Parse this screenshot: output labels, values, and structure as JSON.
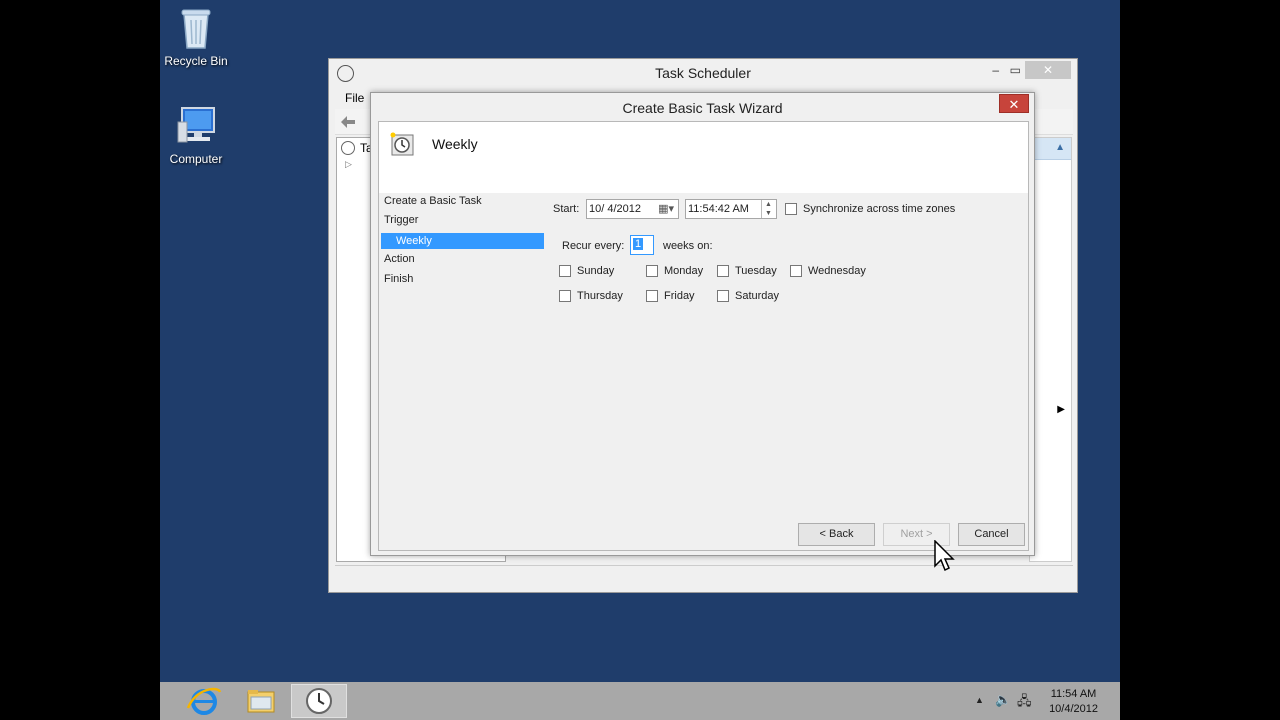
{
  "desktop": {
    "icons": [
      {
        "label": "Recycle Bin",
        "icon": "recycle-bin-icon"
      },
      {
        "label": "Computer",
        "icon": "computer-icon"
      }
    ]
  },
  "task_scheduler": {
    "title": "Task Scheduler",
    "menu": {
      "file": "File"
    },
    "tree_fragment": "Ta"
  },
  "wizard": {
    "title": "Create Basic Task Wizard",
    "header": "Weekly",
    "nav": [
      "Create a Basic Task",
      "Trigger",
      "Weekly",
      "Action",
      "Finish"
    ],
    "start_label": "Start:",
    "date_value": "10/ 4/2012",
    "time_value": "11:54:42 AM",
    "sync_label": "Synchronize across time zones",
    "recur_label": "Recur every:",
    "recur_value": "1",
    "weeks_on_label": "weeks on:",
    "days": [
      "Sunday",
      "Monday",
      "Tuesday",
      "Wednesday",
      "Thursday",
      "Friday",
      "Saturday"
    ],
    "buttons": {
      "back": "< Back",
      "next": "Next >",
      "cancel": "Cancel"
    }
  },
  "taskbar": {
    "time": "11:54 AM",
    "date": "10/4/2012"
  },
  "colors": {
    "desktop": "#1f3d6b",
    "selection": "#3399ff",
    "close": "#c7443b"
  }
}
